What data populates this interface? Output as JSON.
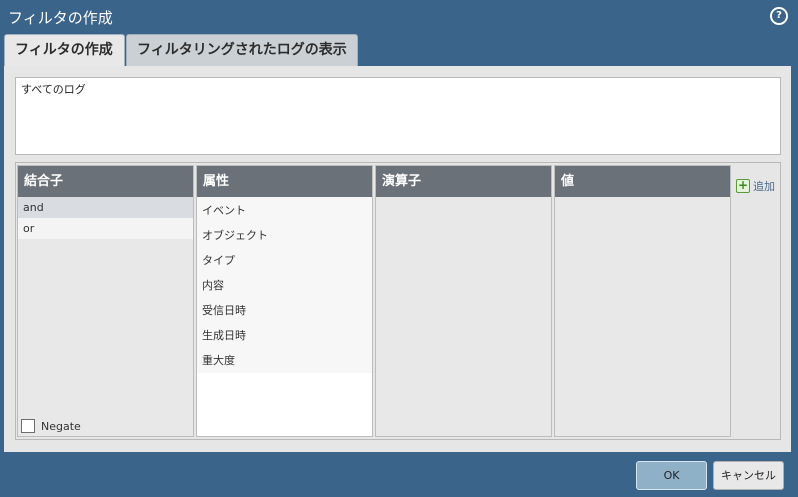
{
  "window": {
    "title": "フィルタの作成",
    "help_icon": "?"
  },
  "tabs": [
    {
      "label": "フィルタの作成",
      "active": true
    },
    {
      "label": "フィルタリングされたログの表示",
      "active": false
    }
  ],
  "filter_text": "すべてのログ",
  "columns": {
    "combiner": {
      "header": "結合子",
      "items": [
        "and",
        "or"
      ],
      "negate_label": "Negate"
    },
    "attribute": {
      "header": "属性",
      "items": [
        "イベント",
        "オブジェクト",
        "タイプ",
        "内容",
        "受信日時",
        "生成日時",
        "重大度"
      ]
    },
    "operator": {
      "header": "演算子"
    },
    "value": {
      "header": "値"
    }
  },
  "add_label": "追加",
  "buttons": {
    "ok": "OK",
    "cancel": "キャンセル"
  },
  "colors": {
    "background": "#3a6489",
    "column_header": "#6b7178",
    "add_icon": "#3a8a1a"
  }
}
